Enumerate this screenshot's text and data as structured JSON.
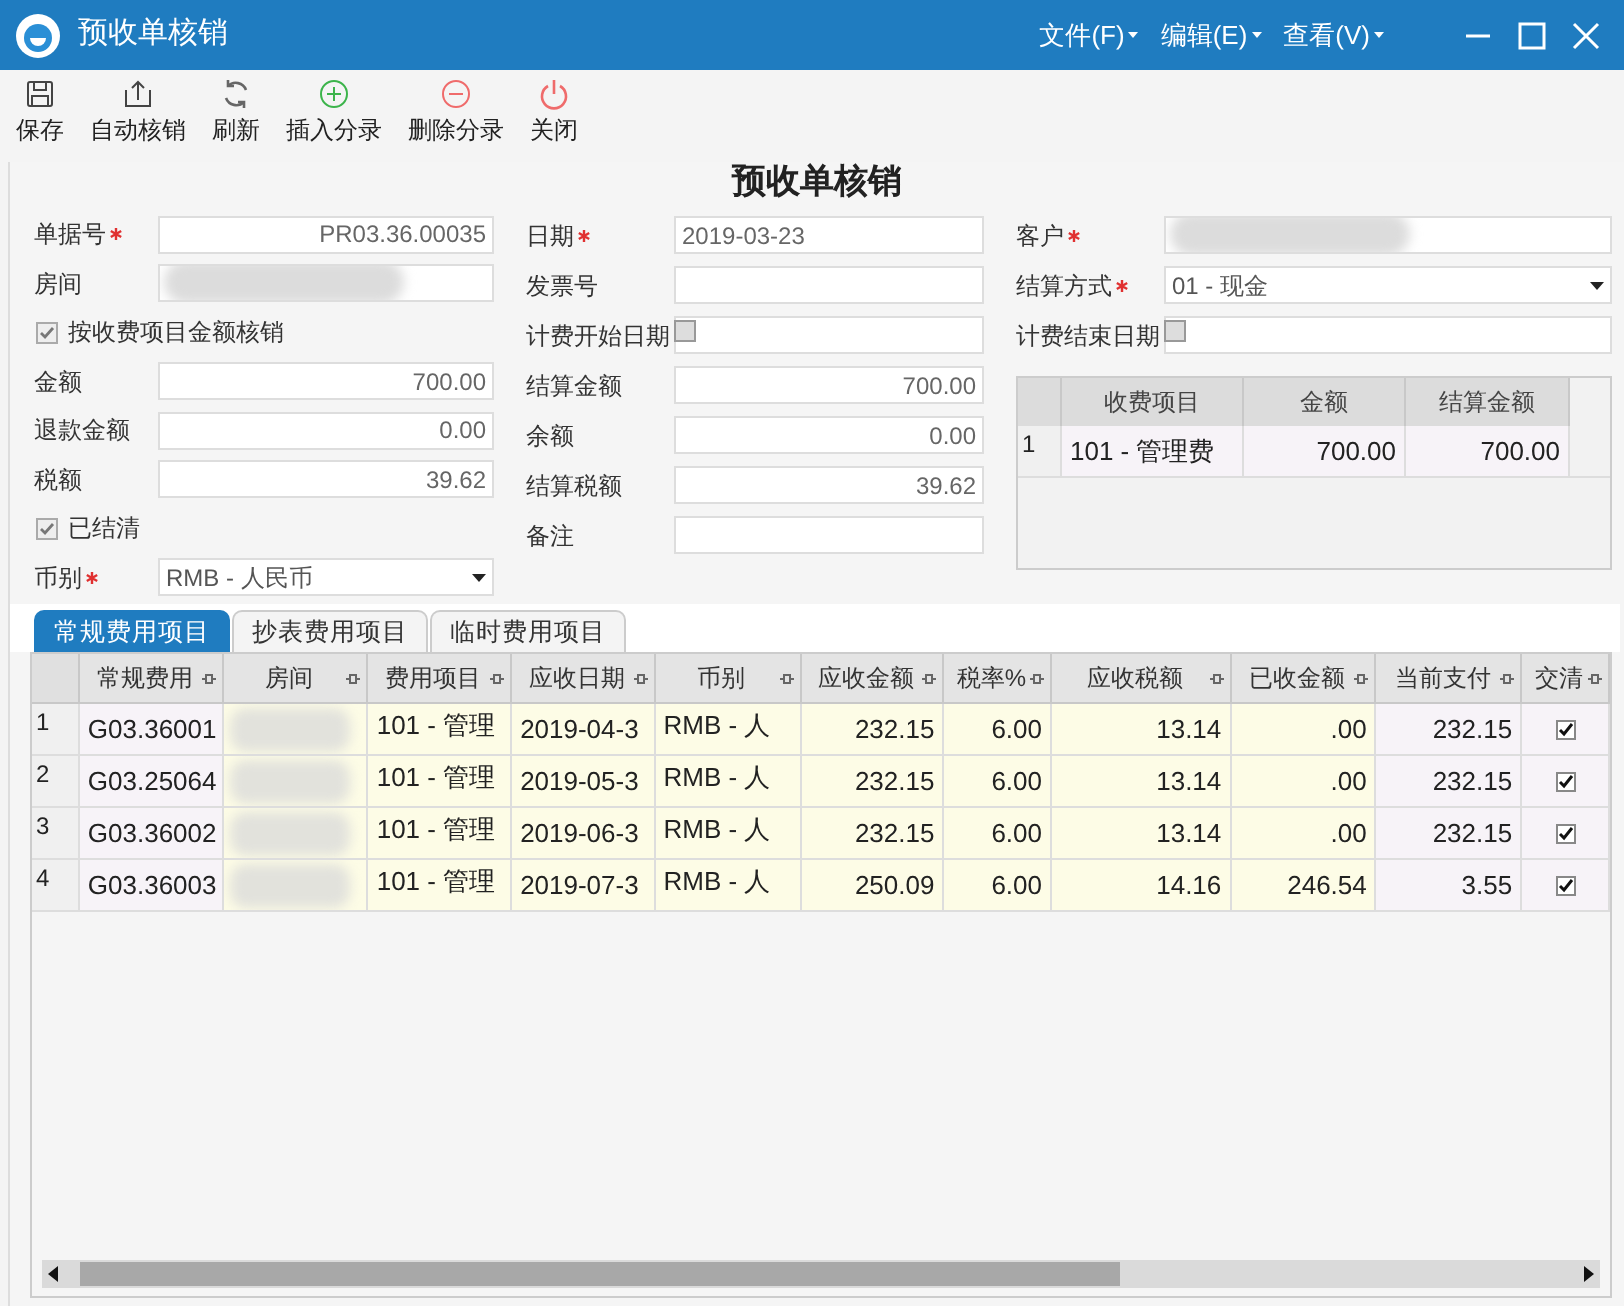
{
  "window": {
    "title": "预收单核销",
    "menus": [
      "文件(F)",
      "编辑(E)",
      "查看(V)"
    ]
  },
  "toolbar": [
    "保存",
    "自动核销",
    "刷新",
    "插入分录",
    "删除分录",
    "关闭"
  ],
  "form": {
    "title": "预收单核销",
    "columns": [
      [
        {
          "kind": "numeric",
          "label": "单据号",
          "required": true,
          "value": "PR03.36.00035"
        },
        {
          "kind": "redacted",
          "label": "房间",
          "required": false
        },
        {
          "kind": "check",
          "label": "按收费项目金额核销",
          "checked": true
        },
        {
          "kind": "numeric",
          "label": "金额",
          "required": false,
          "value": "700.00"
        },
        {
          "kind": "numeric",
          "label": "退款金额",
          "required": false,
          "value": "0.00"
        },
        {
          "kind": "numeric",
          "label": "税额",
          "required": false,
          "value": "39.62"
        },
        {
          "kind": "check",
          "label": "已结清",
          "checked": true
        },
        {
          "kind": "select",
          "label": "币别",
          "required": true,
          "value": "RMB - 人民币"
        }
      ],
      [
        {
          "kind": "text",
          "label": "日期",
          "required": true,
          "value": "2019-03-23"
        },
        {
          "kind": "text",
          "label": "发票号",
          "required": false
        },
        {
          "kind": "date_check",
          "label": "计费开始日期",
          "checked": false
        },
        {
          "kind": "numeric",
          "label": "结算金额",
          "required": false,
          "value": "700.00"
        },
        {
          "kind": "numeric",
          "label": "余额",
          "required": false,
          "value": "0.00"
        },
        {
          "kind": "numeric",
          "label": "结算税额",
          "required": false,
          "value": "39.62"
        },
        {
          "kind": "text",
          "label": "备注",
          "required": false
        }
      ],
      [
        {
          "kind": "redacted",
          "label": "客户",
          "required": true
        },
        {
          "kind": "select",
          "label": "结算方式",
          "required": true,
          "value": "01 - 现金"
        },
        {
          "kind": "date_check",
          "label": "计费结束日期",
          "checked": false
        }
      ]
    ]
  },
  "fee_table": {
    "columns": [
      "收费项目",
      "金额",
      "结算金额"
    ],
    "rows": [
      {
        "number": "1",
        "cells": [
          "101 - 管理费",
          "700.00",
          "700.00"
        ]
      }
    ]
  },
  "tabs": [
    {
      "label": "常规费用项目",
      "selected": true
    },
    {
      "label": "抄表费用项目",
      "selected": false
    },
    {
      "label": "临时费用项目",
      "selected": false
    }
  ],
  "grid": {
    "columns": [
      "常规费用",
      "房间",
      "费用项目",
      "应收日期",
      "币别",
      "应收金额",
      "税率%",
      "应收税额",
      "已收金额",
      "当前支付",
      "交清"
    ],
    "rows": [
      {
        "number": "1",
        "code": "G03.36001",
        "item": "101 - 管理",
        "date": "2019-04-3",
        "currency": "RMB - 人",
        "amount": "232.15",
        "rate": "6.00",
        "tax": "13.14",
        "received": ".00",
        "payment": "232.15",
        "settled": true
      },
      {
        "number": "2",
        "code": "G03.25064",
        "item": "101 - 管理",
        "date": "2019-05-3",
        "currency": "RMB - 人",
        "amount": "232.15",
        "rate": "6.00",
        "tax": "13.14",
        "received": ".00",
        "payment": "232.15",
        "settled": true
      },
      {
        "number": "3",
        "code": "G03.36002",
        "item": "101 - 管理",
        "date": "2019-06-3",
        "currency": "RMB - 人",
        "amount": "232.15",
        "rate": "6.00",
        "tax": "13.14",
        "received": ".00",
        "payment": "232.15",
        "settled": true
      },
      {
        "number": "4",
        "code": "G03.36003",
        "item": "101 - 管理",
        "date": "2019-07-3",
        "currency": "RMB - 人",
        "amount": "250.09",
        "rate": "6.00",
        "tax": "14.16",
        "received": "246.54",
        "payment": "3.55",
        "settled": true
      }
    ]
  }
}
